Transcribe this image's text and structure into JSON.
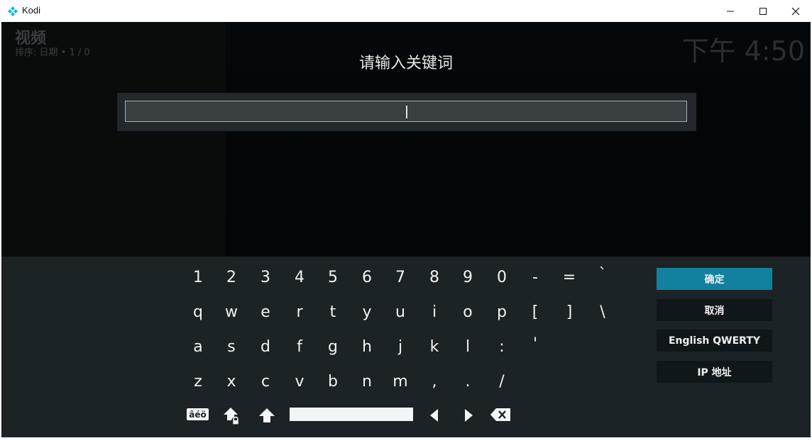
{
  "window": {
    "title": "Kodi",
    "accent": "#12809f"
  },
  "background": {
    "section_title": "视频",
    "sort_info": "排序: 日期  •  1 / 0",
    "clock": "下午 4:50"
  },
  "dialog": {
    "title": "请输入关键词",
    "input_value": ""
  },
  "keyboard": {
    "rows": [
      [
        "1",
        "2",
        "3",
        "4",
        "5",
        "6",
        "7",
        "8",
        "9",
        "0",
        "-",
        "=",
        "`"
      ],
      [
        "q",
        "w",
        "e",
        "r",
        "t",
        "y",
        "u",
        "i",
        "o",
        "p",
        "[",
        "]",
        "\\"
      ],
      [
        "a",
        "s",
        "d",
        "f",
        "g",
        "h",
        "j",
        "k",
        "l",
        ":",
        "'"
      ],
      [
        "z",
        "x",
        "c",
        "v",
        "b",
        "n",
        "m",
        ",",
        ".",
        "/"
      ]
    ],
    "symbols_label": "âéö",
    "icons": [
      "caps-lock-icon",
      "shift-icon",
      "space-bar",
      "arrow-left-icon",
      "arrow-right-icon",
      "backspace-icon"
    ]
  },
  "actions": {
    "ok": "确定",
    "cancel": "取消",
    "layout": "English QWERTY",
    "ip": "IP 地址"
  }
}
